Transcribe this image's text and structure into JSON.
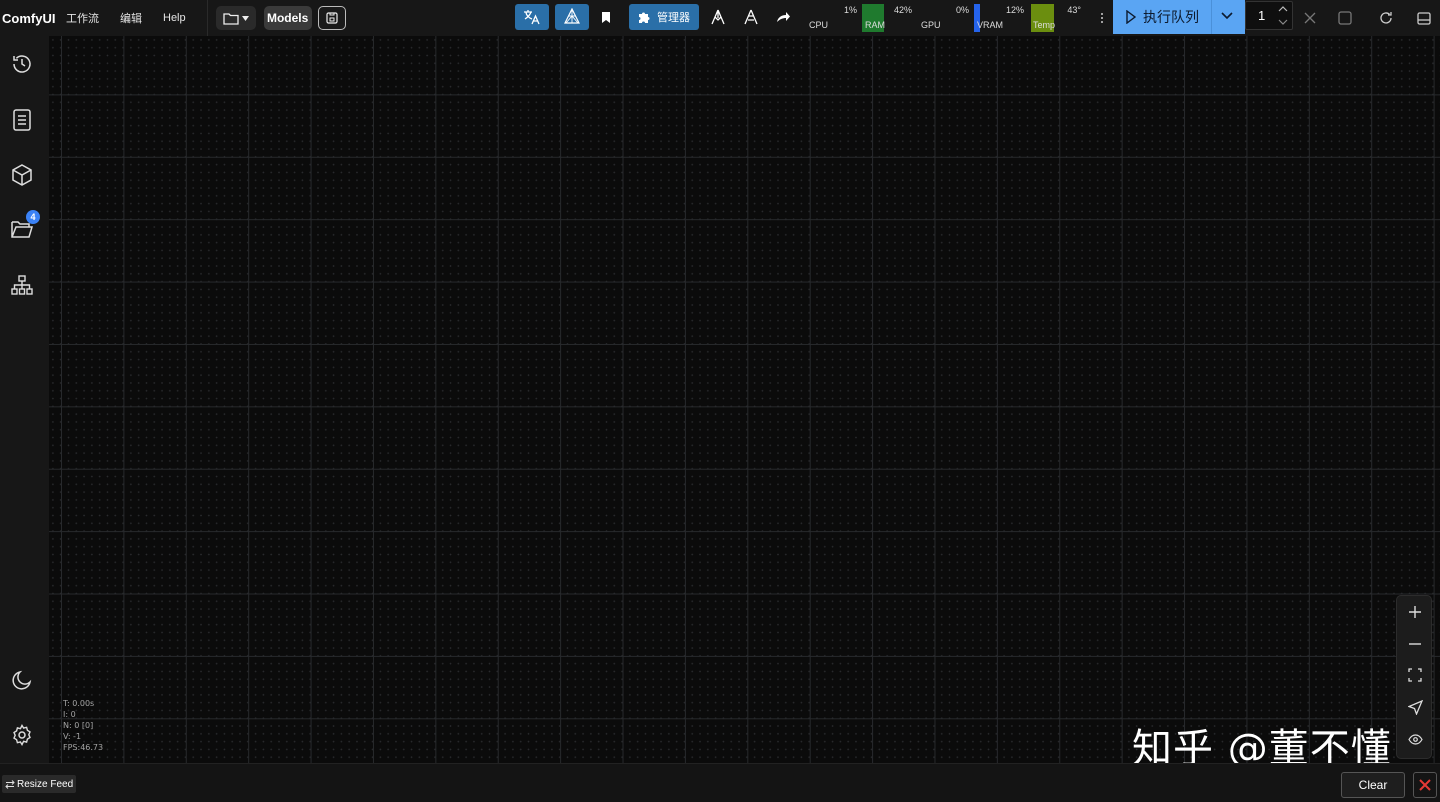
{
  "app": {
    "brand": "ComfyUI"
  },
  "menu": [
    {
      "label": "工作流"
    },
    {
      "label": "编辑"
    },
    {
      "label": "Help"
    }
  ],
  "toolbar": {
    "models_label": "Models",
    "manager_label": "管理器",
    "queue_label": "执行队列",
    "batch_count": "1",
    "accent_color": "#2a6fa8",
    "queue_color": "#5aa5f3"
  },
  "monitors": {
    "cpu": {
      "label": "CPU",
      "value": "1%",
      "level": 0.01
    },
    "ram": {
      "label": "RAM",
      "value": "42%",
      "level": 0.42,
      "color": "#1f7a2e"
    },
    "gpu": {
      "label": "GPU",
      "value": "0%",
      "level": 0.0
    },
    "vram": {
      "label": "VRAM",
      "value": "12%",
      "level": 0.12,
      "color": "#2563eb"
    },
    "temp": {
      "label": "Temp",
      "value": "43°",
      "level": 0.43,
      "color": "#6b8e0f"
    }
  },
  "sidebar": {
    "items": [
      {
        "icon": "history-icon"
      },
      {
        "icon": "document-icon"
      },
      {
        "icon": "cube-icon"
      },
      {
        "icon": "folder-open-icon",
        "badge": "4"
      },
      {
        "icon": "node-tree-icon"
      },
      {
        "icon": "moon-icon"
      },
      {
        "icon": "gear-icon"
      }
    ]
  },
  "canvas_stats": {
    "t": "T: 0.00s",
    "i": "I: 0",
    "n": "N: 0 [0]",
    "v": "V: -1",
    "fps": "FPS:46.73"
  },
  "watermark": "知乎 @董不懂",
  "bottom": {
    "resize_label": "Resize Feed",
    "clear_label": "Clear"
  }
}
